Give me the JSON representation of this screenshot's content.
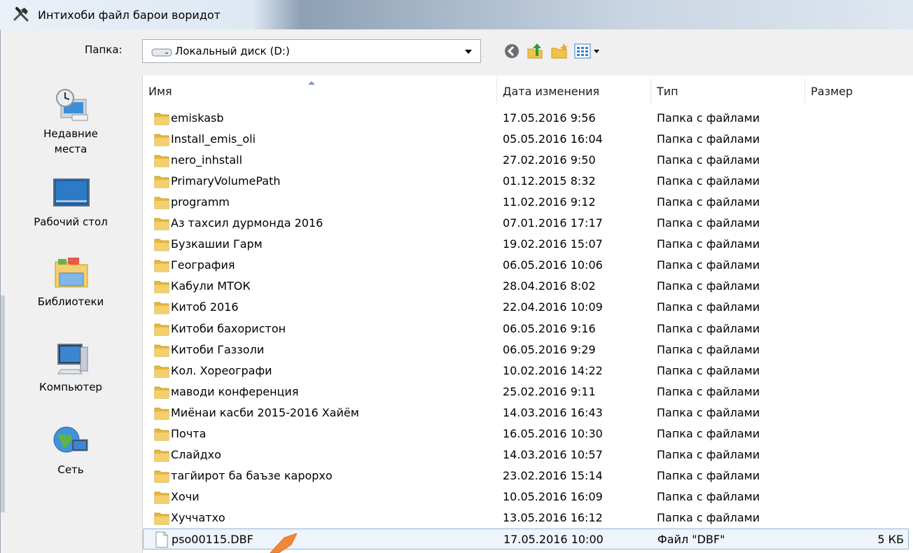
{
  "window": {
    "title": "Интихоби файл барои воридот"
  },
  "folder_bar": {
    "label": "Папка:",
    "value": "Локальный диск (D:)"
  },
  "places": [
    {
      "label_line1": "Недавние",
      "label_line2": "места",
      "icon": "recent-places-icon"
    },
    {
      "label_line1": "Рабочий стол",
      "label_line2": "",
      "icon": "desktop-icon"
    },
    {
      "label_line1": "Библиотеки",
      "label_line2": "",
      "icon": "libraries-icon"
    },
    {
      "label_line1": "Компьютер",
      "label_line2": "",
      "icon": "computer-icon"
    },
    {
      "label_line1": "Сеть",
      "label_line2": "",
      "icon": "network-icon"
    }
  ],
  "columns": {
    "name": "Имя",
    "date": "Дата изменения",
    "type": "Тип",
    "size": "Размер"
  },
  "files": [
    {
      "name": "emiskasb",
      "date": "17.05.2016 9:56",
      "type": "Папка с файлами",
      "size": ""
    },
    {
      "name": "Install_emis_oli",
      "date": "05.05.2016 16:04",
      "type": "Папка с файлами",
      "size": ""
    },
    {
      "name": "nero_inhstall",
      "date": "27.02.2016 9:50",
      "type": "Папка с файлами",
      "size": ""
    },
    {
      "name": "PrimaryVolumePath",
      "date": "01.12.2015 8:32",
      "type": "Папка с файлами",
      "size": ""
    },
    {
      "name": "programm",
      "date": "11.02.2016 9:12",
      "type": "Папка с файлами",
      "size": ""
    },
    {
      "name": "Аз тахсил дурмонда 2016",
      "date": "07.01.2016 17:17",
      "type": "Папка с файлами",
      "size": ""
    },
    {
      "name": "Бузкашии Гарм",
      "date": "19.02.2016 15:07",
      "type": "Папка с файлами",
      "size": ""
    },
    {
      "name": "География",
      "date": "06.05.2016 10:06",
      "type": "Папка с файлами",
      "size": ""
    },
    {
      "name": "Кабули МТОК",
      "date": "28.04.2016 8:02",
      "type": "Папка с файлами",
      "size": ""
    },
    {
      "name": "Китоб 2016",
      "date": "22.04.2016 10:09",
      "type": "Папка с файлами",
      "size": ""
    },
    {
      "name": "Китоби бахористон",
      "date": "06.05.2016 9:16",
      "type": "Папка с файлами",
      "size": ""
    },
    {
      "name": "Китоби Газзоли",
      "date": "06.05.2016 9:29",
      "type": "Папка с файлами",
      "size": ""
    },
    {
      "name": "Кол. Хореографи",
      "date": "10.02.2016 14:22",
      "type": "Папка с файлами",
      "size": ""
    },
    {
      "name": "маводи конференция",
      "date": "25.02.2016 9:11",
      "type": "Папка с файлами",
      "size": ""
    },
    {
      "name": "Миёнаи касби 2015-2016 Хайём",
      "date": "14.03.2016 16:43",
      "type": "Папка с файлами",
      "size": ""
    },
    {
      "name": "Почта",
      "date": "16.05.2016 10:30",
      "type": "Папка с файлами",
      "size": ""
    },
    {
      "name": "Слайдхо",
      "date": "14.03.2016 10:57",
      "type": "Папка с файлами",
      "size": ""
    },
    {
      "name": "тагйирот ба баъзе карорхо",
      "date": "23.02.2016 15:14",
      "type": "Папка с файлами",
      "size": ""
    },
    {
      "name": "Хочи",
      "date": "10.05.2016 16:09",
      "type": "Папка с файлами",
      "size": ""
    },
    {
      "name": "Хуччатхо",
      "date": "13.05.2016 16:12",
      "type": "Папка с файлами",
      "size": ""
    },
    {
      "name": "pso00115.DBF",
      "date": "17.05.2016 10:00",
      "type": "Файл \"DBF\"",
      "size": "5 КБ"
    }
  ],
  "colors": {
    "folder": "#e8b93c",
    "selection_border": "#8fb3db",
    "pointer": "#f0883a"
  }
}
